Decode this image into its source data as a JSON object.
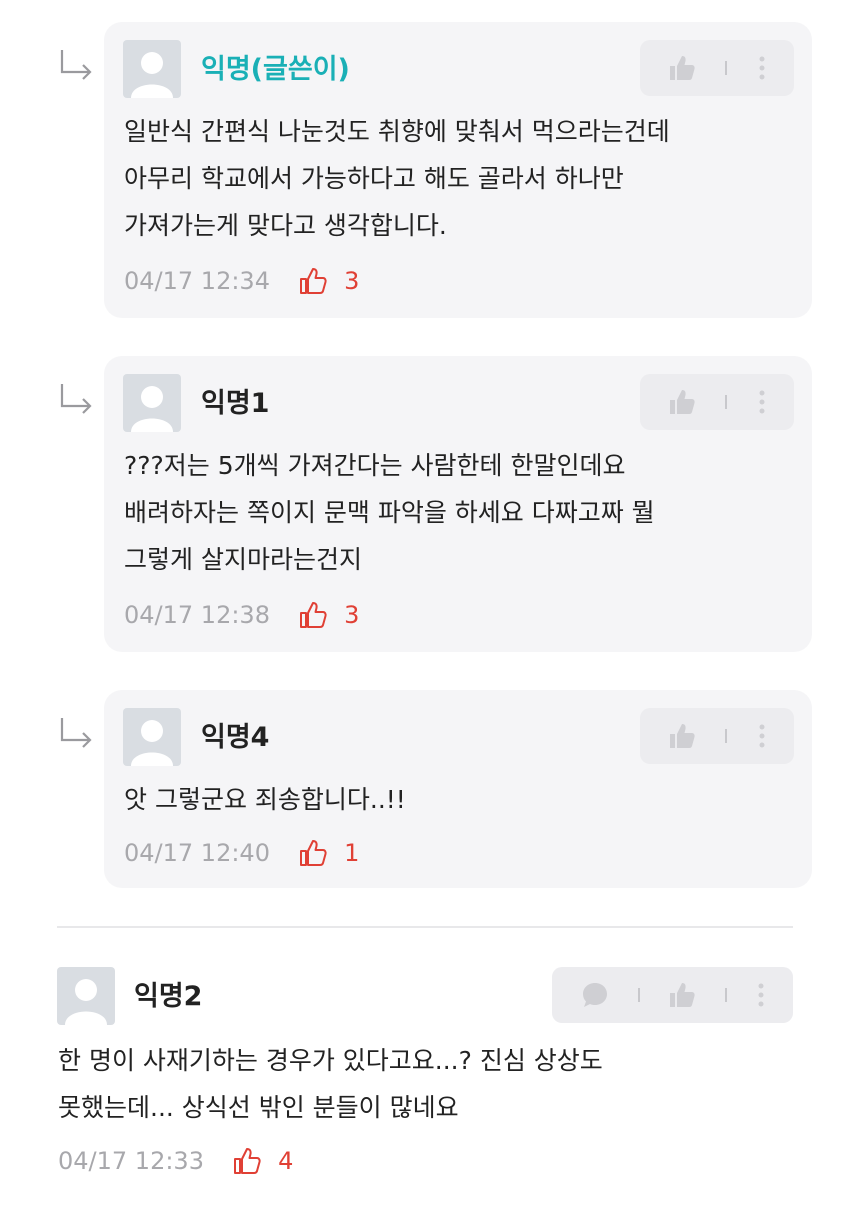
{
  "colors": {
    "op_author": "#1ab0b6",
    "like_red": "#e04035",
    "card_bg": "#f5f5f7",
    "meta_gray": "#a8a8ac"
  },
  "icons": {
    "reply": "reply-arrow-icon",
    "thumbs_up": "thumbs-up-icon",
    "more": "more-vertical-icon",
    "comment": "speech-bubble-icon",
    "like": "like-outline-icon"
  },
  "replies": [
    {
      "author": "익명(글쓴이)",
      "text": "일반식 간편식 나눈것도 취향에 맞춰서 먹으라는건데\n아무리 학교에서 가능하다고 해도 골라서 하나만\n가져가는게 맞다고 생각합니다.",
      "time": "04/17 12:34",
      "likes": "3"
    },
    {
      "author": "익명1",
      "text": "???저는 5개씩 가져간다는 사람한테 한말인데요\n배려하자는 쪽이지 문맥 파악을 하세요 다짜고짜 뭘\n그렇게 살지마라는건지",
      "time": "04/17 12:38",
      "likes": "3"
    },
    {
      "author": "익명4",
      "text": "앗 그렇군요 죄송합니다..!!",
      "time": "04/17 12:40",
      "likes": "1"
    }
  ],
  "comment": {
    "author": "익명2",
    "text": "한 명이 사재기하는 경우가 있다고요...? 진심 상상도\n못했는데... 상식선 밖인 분들이 많네요",
    "time": "04/17 12:33",
    "likes": "4"
  }
}
